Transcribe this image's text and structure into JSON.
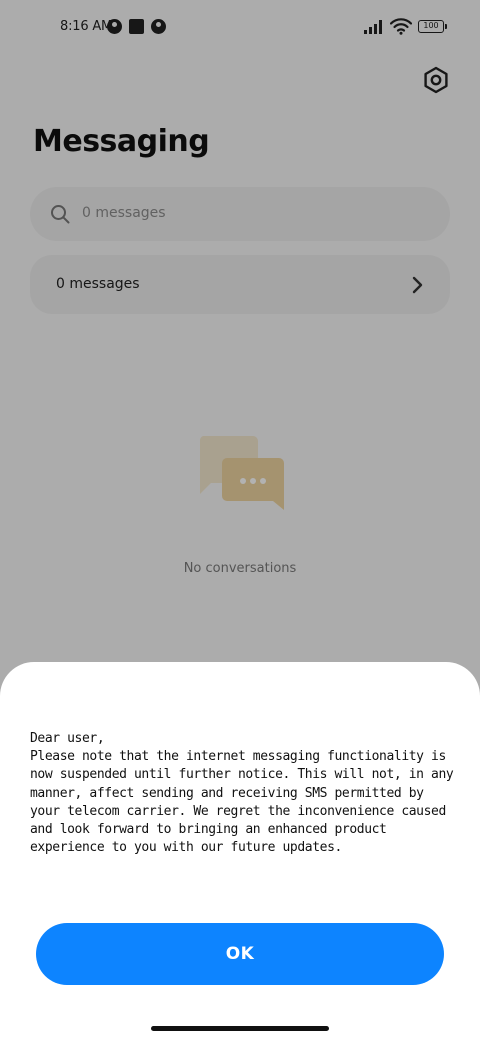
{
  "status_bar": {
    "time": "8:16 AM",
    "battery": "100",
    "icons": [
      "notification-circle-icon",
      "notification-square-icon",
      "notification-circle-icon",
      "signal-icon",
      "wifi-icon",
      "battery-icon"
    ]
  },
  "header": {
    "title": "Messaging",
    "settings_icon": "gear-icon"
  },
  "search": {
    "placeholder": "0 messages",
    "icon": "search-icon"
  },
  "messages_row": {
    "label": "0 messages",
    "icon": "chevron-right-icon"
  },
  "empty_state": {
    "text": "No conversations",
    "icon": "chat-bubbles-icon",
    "colors": {
      "back_bubble": "#f3e7cd",
      "front_bubble": "#edd39f",
      "dots": "#ffffff"
    }
  },
  "dialog": {
    "message": "Dear user,\nPlease note that the internet messaging functionality is now suspended until further notice. This will not, in any manner, affect sending and receiving SMS permitted by your telecom carrier. We regret the inconvenience caused and look forward to bringing an enhanced product experience to you with our future updates.",
    "ok_label": "OK",
    "ok_color": "#0d84ff"
  }
}
